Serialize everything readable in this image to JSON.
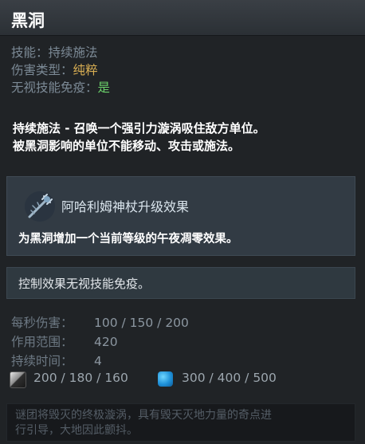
{
  "ability": {
    "name": "黑洞"
  },
  "meta": {
    "skill_label": "技能：",
    "skill_value": "持续施法",
    "damage_type_label": "伤害类型：",
    "damage_type_value": "纯粹",
    "pierce_label": "无视技能免疫：",
    "pierce_value": "是",
    "value_colors": {
      "damage_type": "#d8ae53",
      "pierce": "#6bd26b"
    }
  },
  "description": {
    "line1": "持续施法 - 召唤一个强引力漩涡吸住敌方单位。",
    "line2": "被黑洞影响的单位不能移动、攻击或施法。"
  },
  "scepter": {
    "icon": "aghanims-scepter-icon",
    "title": "阿哈利姆神杖升级效果",
    "text": "为黑洞增加一个当前等级的午夜凋零效果。"
  },
  "note": "控制效果无视技能免疫。",
  "stats": [
    {
      "label": "每秒伤害：",
      "value": "100 / 150 / 200"
    },
    {
      "label": "作用范围：",
      "value": "420"
    },
    {
      "label": "持续时间：",
      "value": "4"
    }
  ],
  "costs": {
    "cooldown_icon": "cooldown-icon",
    "cooldown": "200 / 180 / 160",
    "mana_icon": "mana-icon",
    "mana": "300 / 400 / 500"
  },
  "lore": {
    "line1": "谜团将毁灭的终极漩涡，具有毁天灭地力量的奇点进",
    "line2": "行引导，大地因此颤抖。"
  }
}
